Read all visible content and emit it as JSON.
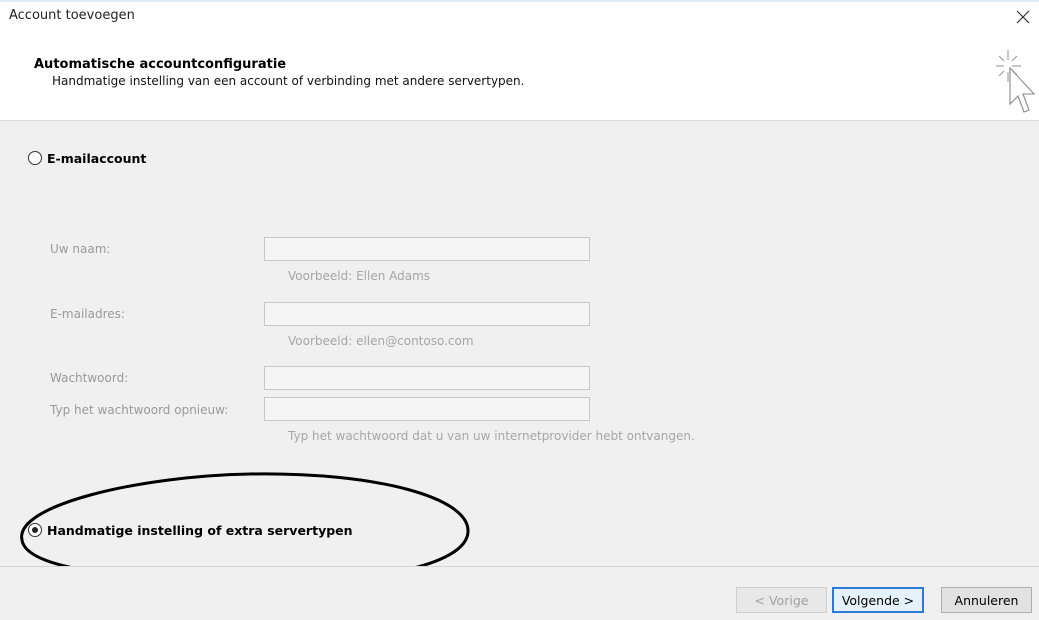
{
  "window": {
    "title": "Account toevoegen"
  },
  "header": {
    "title": "Automatische accountconfiguratie",
    "subtitle": "Handmatige instelling van een account of verbinding met andere servertypen."
  },
  "options": {
    "email_account": {
      "label": "E-mailaccount",
      "selected": false
    },
    "manual": {
      "label": "Handmatige instelling of extra servertypen",
      "selected": true
    }
  },
  "form": {
    "name_label": "Uw naam:",
    "name_value": "",
    "name_hint": "Voorbeeld: Ellen Adams",
    "email_label": "E-mailadres:",
    "email_value": "",
    "email_hint": "Voorbeeld: ellen@contoso.com",
    "password_label": "Wachtwoord:",
    "password_value": "",
    "password_retype_label": "Typ het wachtwoord opnieuw:",
    "password_retype_value": "",
    "password_hint": "Typ het wachtwoord dat u van uw internetprovider hebt ontvangen."
  },
  "footer": {
    "back_label": "< Vorige",
    "next_label": "Volgende >",
    "cancel_label": "Annuleren"
  },
  "colors": {
    "panel_bg": "#f0f0f0",
    "primary_button_border": "#2c7ad6",
    "disabled_text": "#a0a0a0"
  }
}
